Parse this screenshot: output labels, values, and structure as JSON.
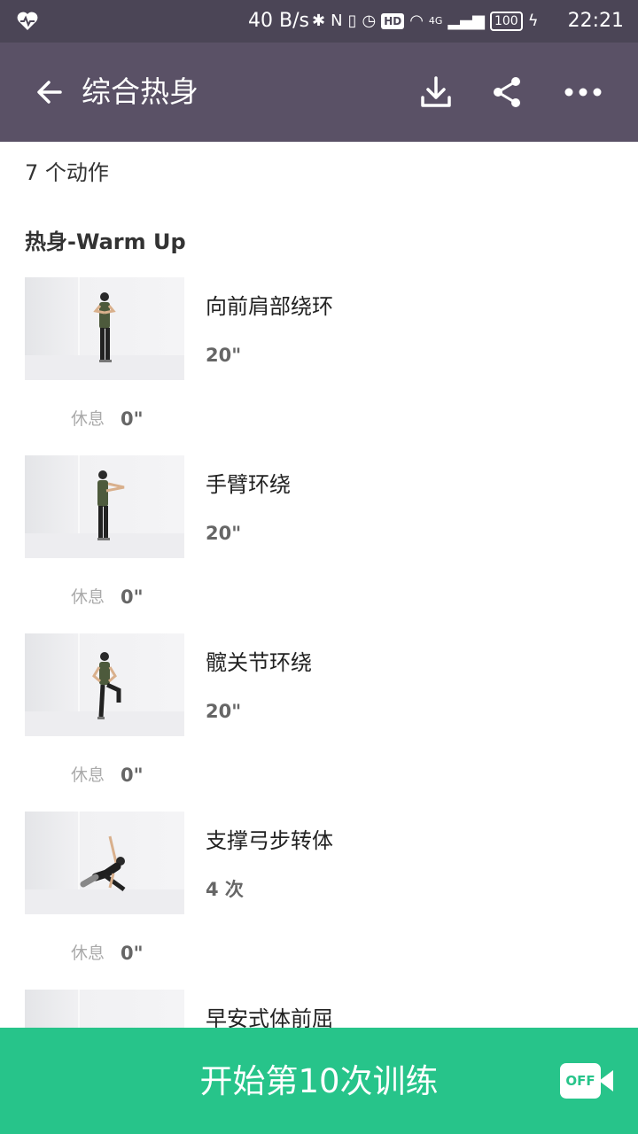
{
  "status_bar": {
    "network_speed": "40 B/s",
    "nfc": "N",
    "hd": "HD",
    "signal": "4G",
    "battery": "100",
    "time": "22:21"
  },
  "header": {
    "title": "综合热身",
    "icons": [
      "back-arrow-icon",
      "download-icon",
      "share-icon",
      "more-icon"
    ]
  },
  "summary": {
    "action_count": "7 个动作"
  },
  "section": {
    "title": "热身-Warm Up"
  },
  "exercises": [
    {
      "name": "向前肩部绕环",
      "amount": "20\"",
      "rest_label": "休息",
      "rest_value": "0\""
    },
    {
      "name": "手臂环绕",
      "amount": "20\"",
      "rest_label": "休息",
      "rest_value": "0\""
    },
    {
      "name": "髋关节环绕",
      "amount": "20\"",
      "rest_label": "休息",
      "rest_value": "0\""
    },
    {
      "name": "支撑弓步转体",
      "amount": "4 次",
      "rest_label": "休息",
      "rest_value": "0\""
    },
    {
      "name": "早安式体前屈",
      "amount": "",
      "rest_label": "",
      "rest_value": ""
    }
  ],
  "footer": {
    "start_label": "开始第10次训练",
    "camera_toggle": "OFF"
  },
  "colors": {
    "status_bar": "#4b4556",
    "app_bar": "#5a5166",
    "accent_green": "#27c48a"
  }
}
